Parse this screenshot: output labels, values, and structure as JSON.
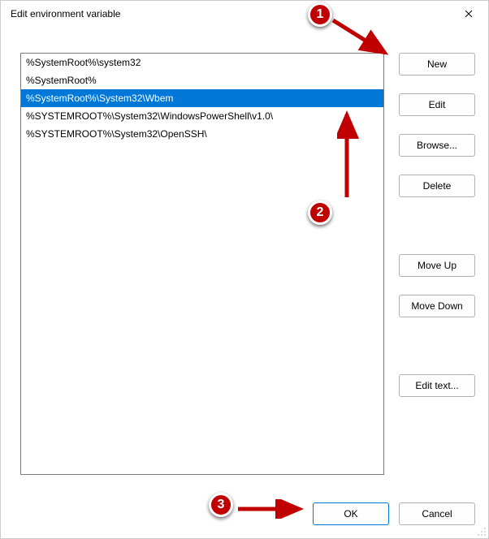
{
  "window": {
    "title": "Edit environment variable"
  },
  "list": {
    "items": [
      {
        "value": "%SystemRoot%\\system32",
        "selected": false
      },
      {
        "value": "%SystemRoot%",
        "selected": false
      },
      {
        "value": "%SystemRoot%\\System32\\Wbem",
        "selected": true
      },
      {
        "value": "%SYSTEMROOT%\\System32\\WindowsPowerShell\\v1.0\\",
        "selected": false
      },
      {
        "value": "%SYSTEMROOT%\\System32\\OpenSSH\\",
        "selected": false
      }
    ]
  },
  "buttons": {
    "new": "New",
    "edit": "Edit",
    "browse": "Browse...",
    "delete": "Delete",
    "move_up": "Move Up",
    "move_down": "Move Down",
    "edit_text": "Edit text...",
    "ok": "OK",
    "cancel": "Cancel"
  },
  "annotations": {
    "a1": "1",
    "a2": "2",
    "a3": "3"
  }
}
